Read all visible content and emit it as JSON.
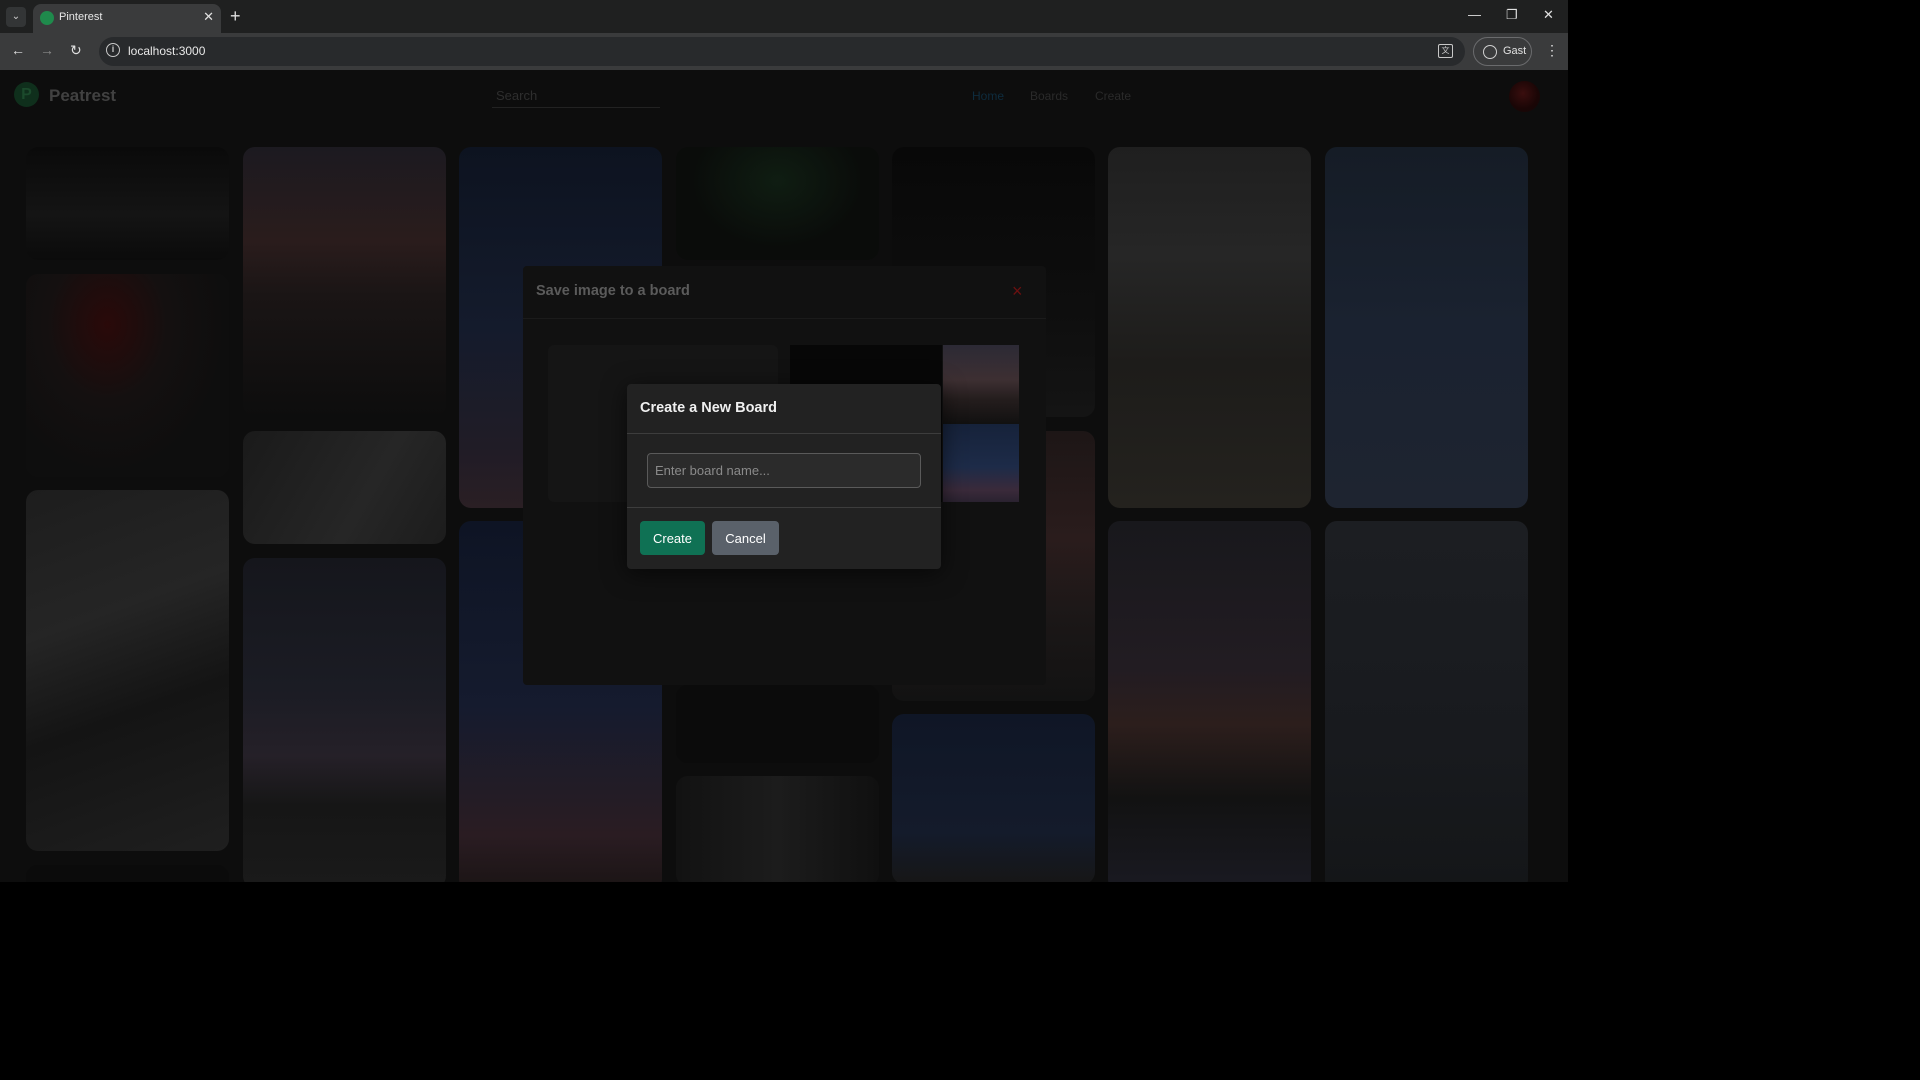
{
  "browser": {
    "tab_title": "Pinterest",
    "url": "localhost:3000",
    "profile_label": "Gast"
  },
  "app": {
    "brand": "Peatrest",
    "search_placeholder": "Search",
    "nav": [
      {
        "label": "Home"
      },
      {
        "label": "Boards"
      },
      {
        "label": "Create"
      }
    ]
  },
  "save_modal": {
    "title": "Save image to a board",
    "close_glyph": "×"
  },
  "create_dialog": {
    "title": "Create a New Board",
    "input_placeholder": "Enter board name...",
    "input_value": "",
    "create_label": "Create",
    "cancel_label": "Cancel"
  },
  "colors": {
    "create_button": "#0f7154",
    "cancel_button": "#5a616a",
    "close_icon": "#b01818",
    "dialog_bg": "#222222"
  }
}
